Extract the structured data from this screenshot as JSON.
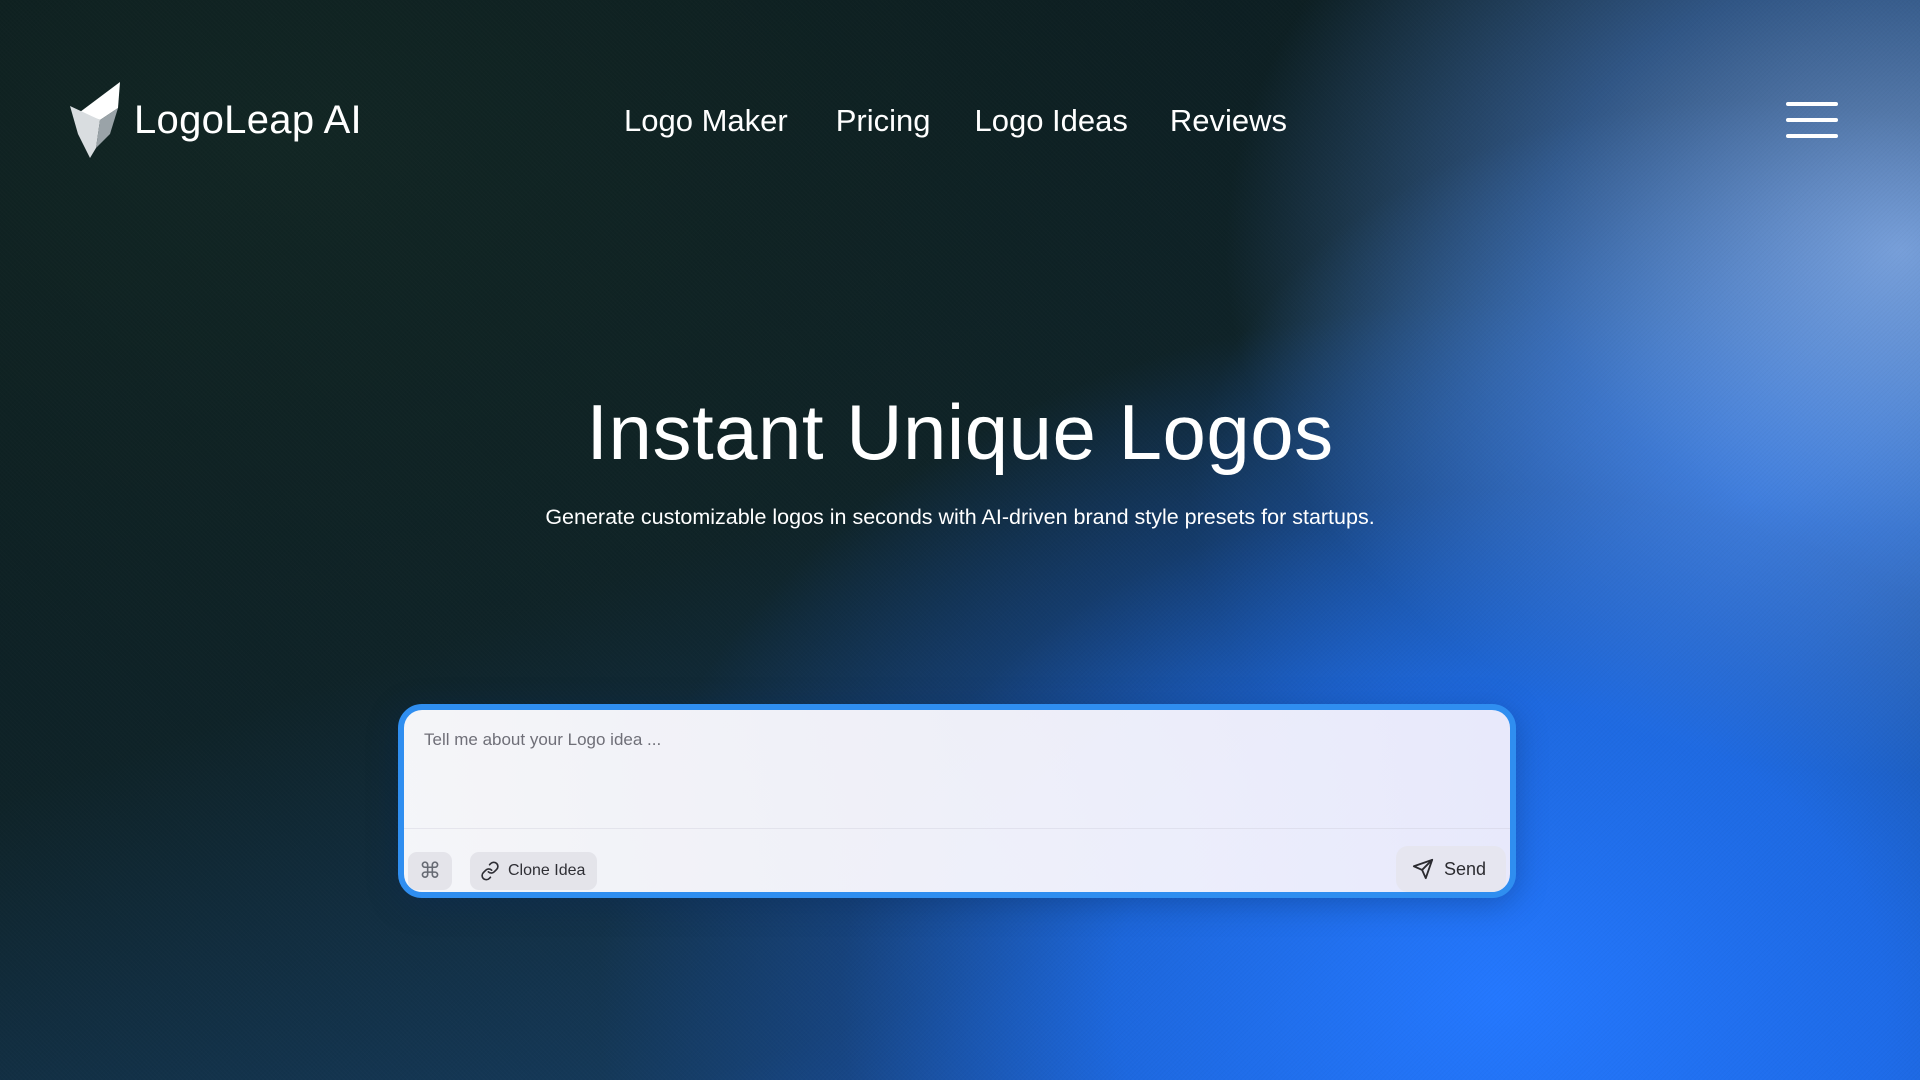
{
  "brand": {
    "name": "LogoLeap AI",
    "logo_icon": "leap-logo-icon"
  },
  "nav": {
    "items": [
      {
        "label": "Logo Maker"
      },
      {
        "label": "Pricing"
      },
      {
        "label": "Logo Ideas"
      },
      {
        "label": "Reviews"
      }
    ],
    "menu_icon": "hamburger-menu-icon"
  },
  "hero": {
    "title": "Instant Unique Logos",
    "subtitle": "Generate customizable logos in seconds with AI-driven brand style presets for startups."
  },
  "prompt": {
    "placeholder": "Tell me about your Logo idea ...",
    "value": "",
    "shortcut_icon": "command-key-icon",
    "clone_label": "Clone Idea",
    "clone_icon": "link-icon",
    "send_label": "Send",
    "send_icon": "send-arrow-icon"
  },
  "colors": {
    "accent_border": "#2f8ef0",
    "background_dark": "#0d1f22",
    "background_blue": "#2478ff",
    "text": "#ffffff"
  }
}
